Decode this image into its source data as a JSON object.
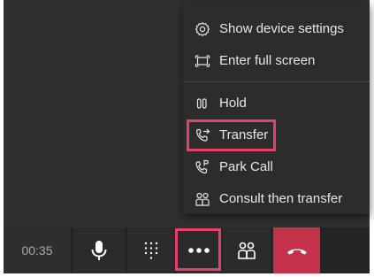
{
  "menu": {
    "items": [
      {
        "id": "show-device-settings",
        "label": "Show device settings",
        "icon": "gear-icon"
      },
      {
        "id": "enter-full-screen",
        "label": "Enter full screen",
        "icon": "fullscreen-icon"
      },
      {
        "id": "hold",
        "label": "Hold",
        "icon": "pause-icon"
      },
      {
        "id": "transfer",
        "label": "Transfer",
        "icon": "transfer-icon"
      },
      {
        "id": "park-call",
        "label": "Park Call",
        "icon": "park-call-icon"
      },
      {
        "id": "consult-then-transfer",
        "label": "Consult then transfer",
        "icon": "people-icon"
      }
    ]
  },
  "toolbar": {
    "timer": "00:35",
    "buttons": [
      {
        "id": "mic",
        "icon": "microphone-icon"
      },
      {
        "id": "dialpad",
        "icon": "dialpad-icon"
      },
      {
        "id": "more-actions",
        "icon": "more-icon"
      },
      {
        "id": "participants",
        "icon": "people-icon"
      },
      {
        "id": "hang-up",
        "icon": "hangup-icon"
      }
    ]
  },
  "colors": {
    "highlight": "#e7416b",
    "hangup": "#c4314b",
    "call_background": "#303030",
    "menu_background": "#2c2c2c",
    "toolbar_background": "#242424"
  }
}
